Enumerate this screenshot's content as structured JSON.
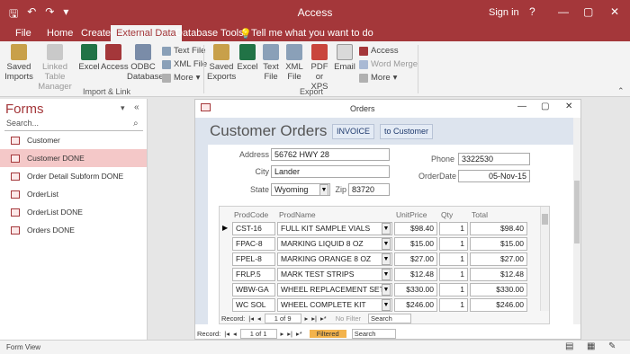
{
  "app": {
    "title": "Access",
    "signin": "Sign in",
    "help": "?",
    "minimize": "—",
    "restore": "▢",
    "close": "✕"
  },
  "tabs": [
    {
      "label": "File"
    },
    {
      "label": "Home"
    },
    {
      "label": "Create"
    },
    {
      "label": "External Data"
    },
    {
      "label": "Database Tools"
    },
    {
      "label": "Tell me what you want to do"
    }
  ],
  "ribbon": {
    "import": {
      "saved_imports": "Saved Imports",
      "linked_table_manager": "Linked Table Manager",
      "excel": "Excel",
      "access": "Access",
      "odbc": "ODBC Database",
      "text_file": "Text File",
      "xml_file": "XML File",
      "more": "More",
      "group_label": "Import & Link"
    },
    "export": {
      "saved_exports": "Saved Exports",
      "excel": "Excel",
      "text_file": "Text File",
      "xml_file": "XML File",
      "pdf": "PDF or XPS",
      "email": "Email",
      "access": "Access",
      "word_merge": "Word Merge",
      "more": "More",
      "group_label": "Export"
    }
  },
  "nav": {
    "title": "Forms",
    "search_placeholder": "Search...",
    "items": [
      {
        "label": "Customer"
      },
      {
        "label": "Customer DONE"
      },
      {
        "label": "Order Detail Subform DONE"
      },
      {
        "label": "OrderList"
      },
      {
        "label": "OrderList DONE"
      },
      {
        "label": "Orders DONE"
      }
    ]
  },
  "form": {
    "window_title": "Orders",
    "heading": "Customer Orders",
    "invoice_button": "INVOICE",
    "to_customer_button": "to Customer",
    "address_label": "Address",
    "address": "56762 HWY 28",
    "city_label": "City",
    "city": "Lander",
    "state_label": "State",
    "state": "Wyoming",
    "zip_label": "Zip",
    "zip": "83720",
    "phone_label": "Phone",
    "phone": "3322530",
    "orderdate_label": "OrderDate",
    "orderdate": "05-Nov-15"
  },
  "subform": {
    "headers": [
      "ProdCode",
      "ProdName",
      "UnitPrice",
      "Qty",
      "Total"
    ],
    "rows": [
      {
        "code": "CST-16",
        "name": "FULL KIT SAMPLE VIALS",
        "price": "$98.40",
        "qty": "1",
        "total": "$98.40"
      },
      {
        "code": "FPAC-8",
        "name": "MARKING LIQUID 8 OZ",
        "price": "$15.00",
        "qty": "1",
        "total": "$15.00"
      },
      {
        "code": "FPEL-8",
        "name": "MARKING ORANGE 8 OZ",
        "price": "$27.00",
        "qty": "1",
        "total": "$27.00"
      },
      {
        "code": "FRLP.5",
        "name": "MARK TEST STRIPS",
        "price": "$12.48",
        "qty": "1",
        "total": "$12.48"
      },
      {
        "code": "WBW-GA",
        "name": "WHEEL REPLACEMENT SET",
        "price": "$330.00",
        "qty": "1",
        "total": "$330.00"
      },
      {
        "code": "WC SOL",
        "name": "WHEEL COMPLETE KIT",
        "price": "$246.00",
        "qty": "1",
        "total": "$246.00"
      }
    ],
    "record_label": "Record:",
    "record_pos": "1 of 9",
    "filter": "No Filter",
    "search": "Search"
  },
  "mainnav": {
    "record_label": "Record:",
    "record_pos": "1 of 1",
    "filter": "Filtered",
    "search": "Search"
  },
  "status": {
    "view": "Form View"
  },
  "colors": {
    "accent": "#a4373a",
    "selected_nav": "#f4c8c8",
    "form_header": "#dde4ee"
  }
}
